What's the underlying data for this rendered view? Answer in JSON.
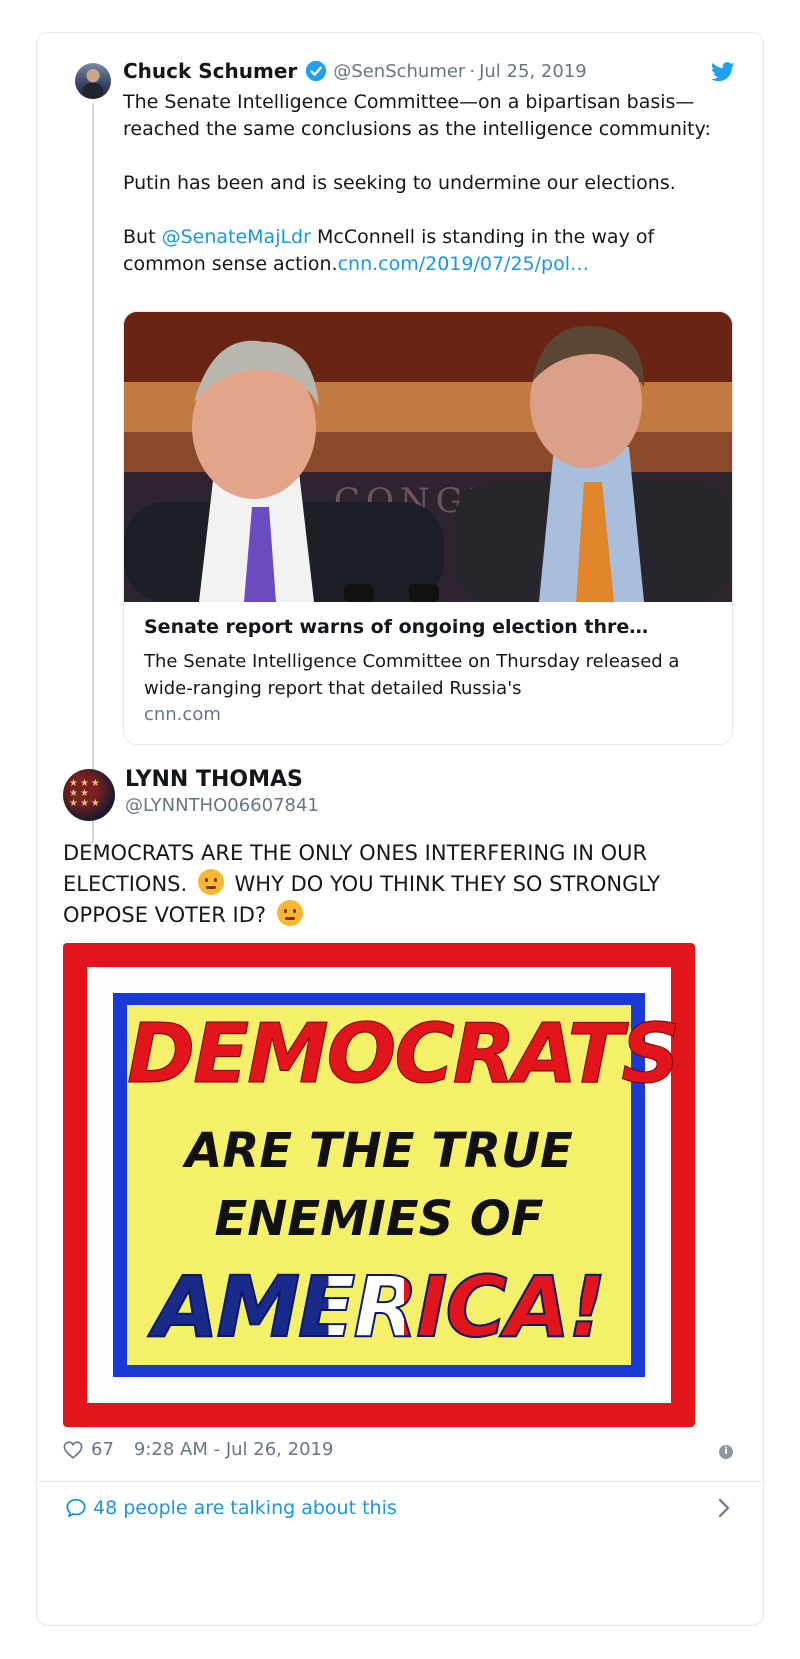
{
  "quoted_tweet": {
    "name": "Chuck Schumer",
    "handle": "@SenSchumer",
    "separator": "·",
    "date": "Jul 25, 2019",
    "text_p1": "The Senate Intelligence Committee—on a bipartisan basis—reached the same conclusions as the intelligence community:",
    "text_p2": "Putin has been and is seeking to undermine our elections.",
    "text_p3_pre": "But ",
    "mention": "@SenateMajLdr",
    "text_p3_post": " McConnell is standing in the way of common sense action.",
    "url": "cnn.com/2019/07/25/pol…",
    "link_card": {
      "title": "Senate report warns of ongoing election thre…",
      "description": "The Senate Intelligence Committee on Thursday released a wide-ranging report that detailed Russia's",
      "domain": "cnn.com",
      "photo_backdrop_text": "CONGRE"
    }
  },
  "tweet": {
    "name": "LYNN THOMAS",
    "handle": "@LYNNTHO06607841",
    "text_part1": "DEMOCRATS ARE THE ONLY ONES INTERFERING IN OUR ELECTIONS.",
    "text_part2": "WHY DO YOU THINK THEY SO STRONGLY OPPOSE VOTER ID?",
    "emoji1": "raised-eyebrow-emoji",
    "emoji2": "thinking-face-emoji",
    "poster": {
      "line1": "DEMOCRATS",
      "line2": "ARE THE TRUE",
      "line3": "ENEMIES OF",
      "line4": "AMERICA!"
    },
    "likes": "67",
    "timestamp": "9:28 AM - Jul 26, 2019",
    "info_icon": "i",
    "talking": "48 people are talking about this"
  },
  "colors": {
    "link": "#1b95e0",
    "muted": "#657786",
    "border": "#e1e8ed",
    "poster_red": "#e2141c",
    "poster_blue": "#1a3ad6",
    "poster_yellow": "#f5f06a"
  }
}
